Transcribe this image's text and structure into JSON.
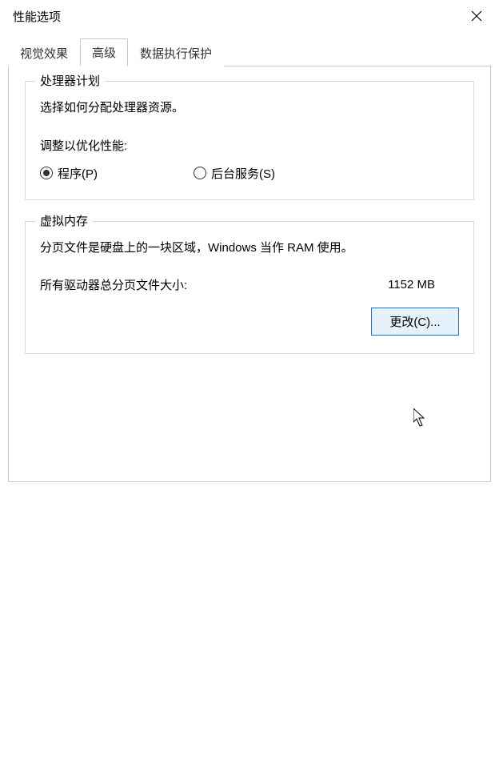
{
  "window": {
    "title": "性能选项"
  },
  "tabs": {
    "visual_effects": "视觉效果",
    "advanced": "高级",
    "dep": "数据执行保护"
  },
  "processor": {
    "legend": "处理器计划",
    "description": "选择如何分配处理器资源。",
    "adjust_label": "调整以优化性能:",
    "programs_label": "程序(P)",
    "background_label": "后台服务(S)",
    "selected": "programs"
  },
  "virtual_memory": {
    "legend": "虚拟内存",
    "description": "分页文件是硬盘上的一块区域，Windows 当作 RAM 使用。",
    "total_label": "所有驱动器总分页文件大小:",
    "total_value": "1152 MB",
    "change_button": "更改(C)..."
  }
}
